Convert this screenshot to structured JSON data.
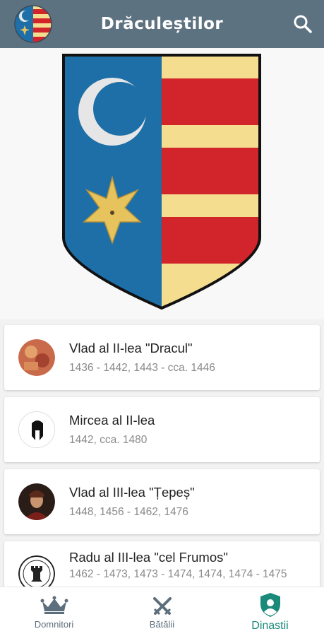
{
  "appbar": {
    "title": "Drăculeștilor",
    "logo_icon": "coat-of-arms-icon",
    "search_icon": "search-icon"
  },
  "hero": {
    "image": "coat-of-arms-shield",
    "colors": {
      "blue": "#1e6fa8",
      "red": "#d1242b",
      "gold": "#f4dd8f",
      "moon": "#e6e6e6",
      "star": "#e6c35c"
    }
  },
  "rulers": [
    {
      "name": "Vlad al II-lea \"Dracul\"",
      "years": "1436 - 1442, 1443 - cca. 1446",
      "avatar": "portrait-vlad-dracul"
    },
    {
      "name": "Mircea al II-lea",
      "years": "1442, cca. 1480",
      "avatar": "helmet-icon"
    },
    {
      "name": "Vlad al III-lea \"Țepeș\"",
      "years": "1448, 1456 - 1462, 1476",
      "avatar": "portrait-vlad-tepes"
    },
    {
      "name": "Radu al III-lea \"cel Frumos\"",
      "years": "1462 - 1473, 1473 - 1474, 1474, 1474 - 1475",
      "avatar": "rook-seal-icon"
    }
  ],
  "nav": {
    "items": [
      {
        "label": "Domnitori",
        "icon": "crown-icon",
        "active": false
      },
      {
        "label": "Bătălii",
        "icon": "crossed-swords-icon",
        "active": false
      },
      {
        "label": "Dinastii",
        "icon": "shield-person-icon",
        "active": true
      }
    ],
    "active_color": "#1b8a7a",
    "inactive_color": "#5d6f7c"
  }
}
